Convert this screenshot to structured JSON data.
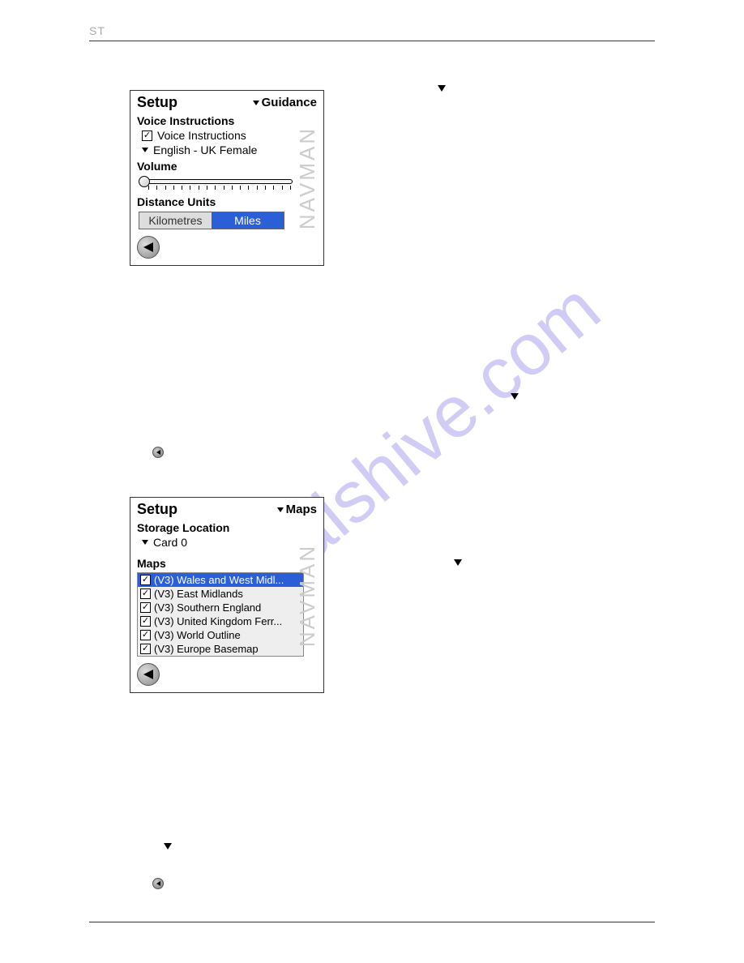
{
  "header": "ST",
  "watermark": "manualshive.com",
  "screen1": {
    "title": "Setup",
    "menu": "Guidance",
    "section_voice": "Voice Instructions",
    "checkbox_voice": "Voice Instructions",
    "voice_dropdown": "English - UK Female",
    "section_volume": "Volume",
    "section_distance": "Distance Units",
    "unit_km": "Kilometres",
    "unit_mi": "Miles",
    "brand": "NAVMAN"
  },
  "screen2": {
    "title": "Setup",
    "menu": "Maps",
    "section_storage": "Storage Location",
    "storage_dropdown": "Card 0",
    "section_maps": "Maps",
    "brand": "NAVMAN",
    "maps": [
      "(V3) Wales and West Midl...",
      "(V3) East Midlands",
      "(V3) Southern England",
      "(V3) United Kingdom Ferr...",
      "(V3) World Outline",
      "(V3) Europe Basemap"
    ]
  }
}
